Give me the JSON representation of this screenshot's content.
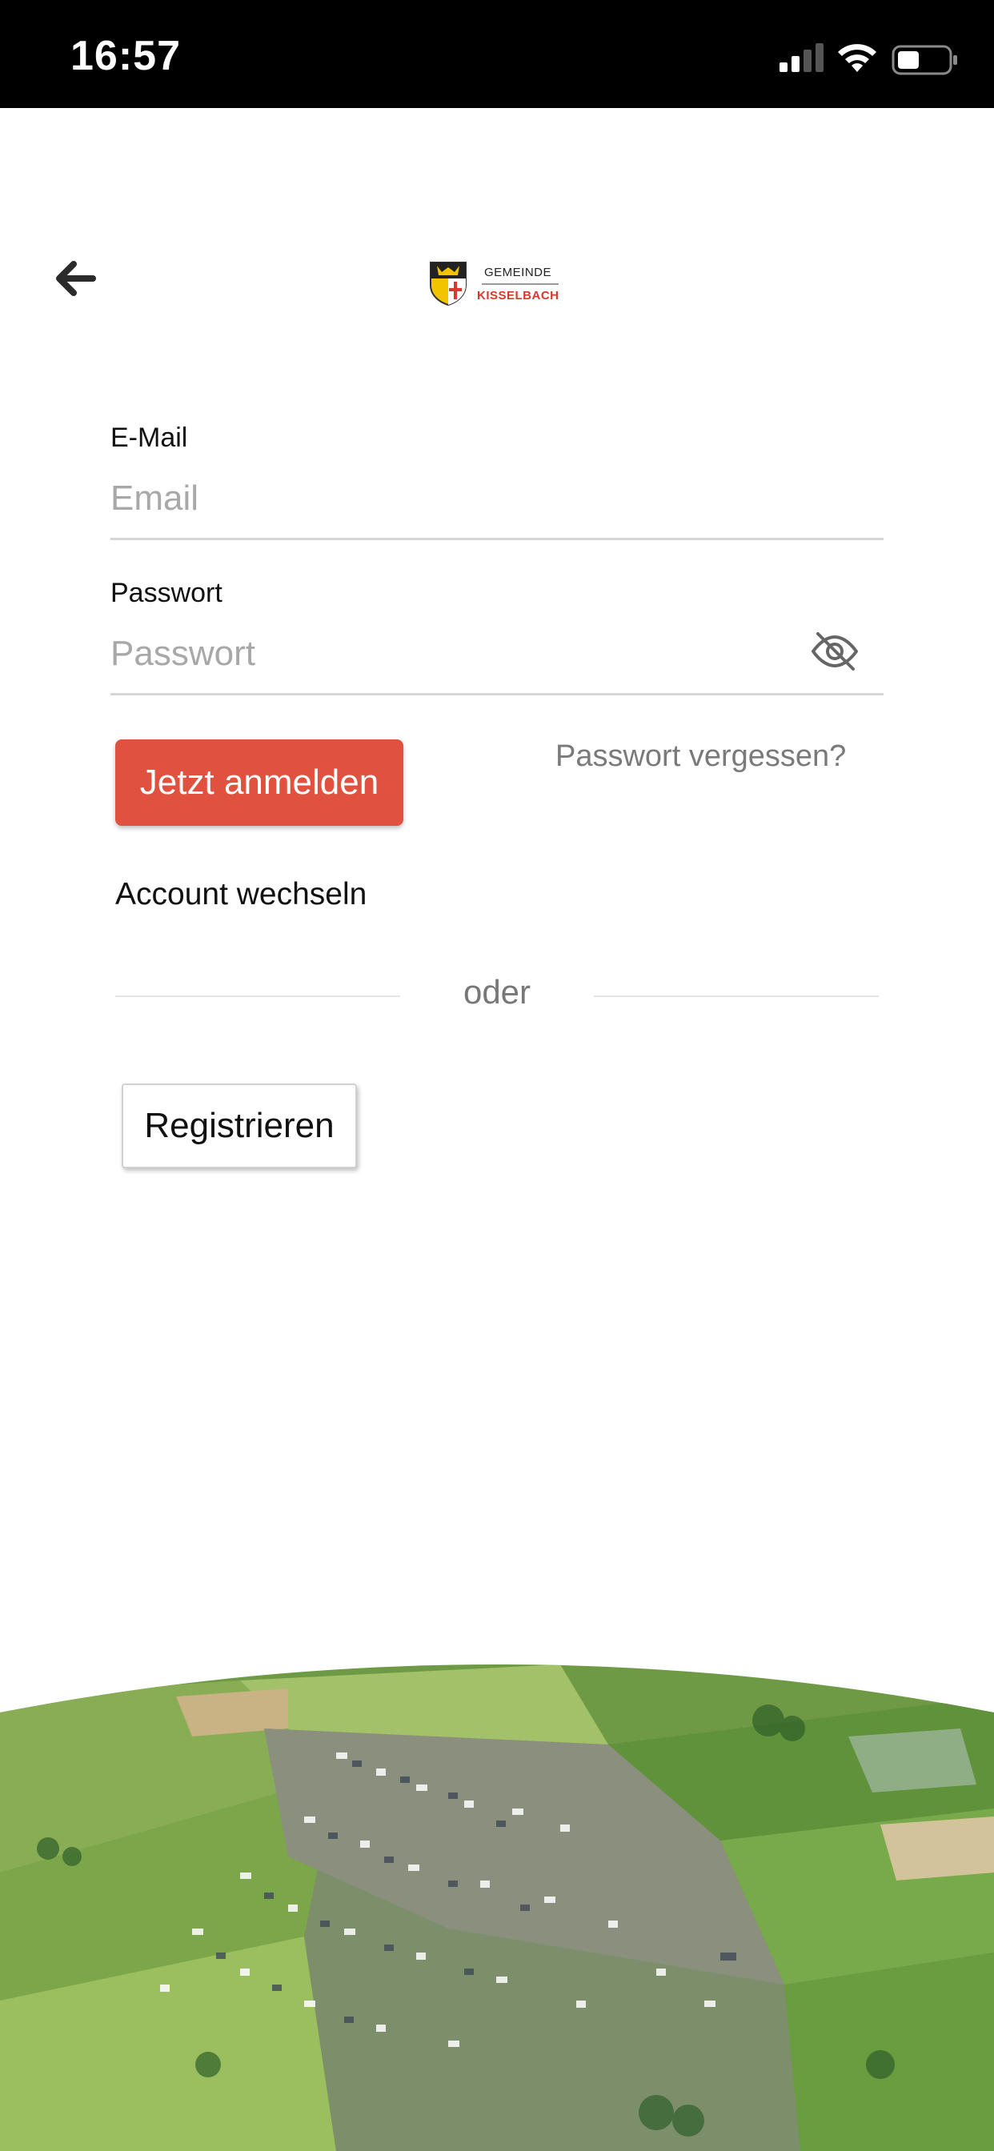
{
  "status_bar": {
    "time": "16:57",
    "icons": [
      "signal-icon",
      "wifi-icon",
      "battery-icon"
    ]
  },
  "header": {
    "back_icon": "arrow-left-icon",
    "logo": {
      "top": "GEMEINDE",
      "bottom": "KISSELBACH"
    }
  },
  "form": {
    "email": {
      "label": "E-Mail",
      "placeholder": "Email",
      "value": ""
    },
    "password": {
      "label": "Passwort",
      "placeholder": "Passwort",
      "value": "",
      "toggle_icon": "eye-off-icon"
    },
    "login_label": "Jetzt anmelden",
    "forgot_label": "Passwort vergessen?",
    "switch_account_label": "Account wechseln",
    "divider_label": "oder",
    "register_label": "Registrieren"
  },
  "colors": {
    "accent": "#e0513f",
    "logo_red": "#d63a2d",
    "statusbar": "#000000"
  }
}
